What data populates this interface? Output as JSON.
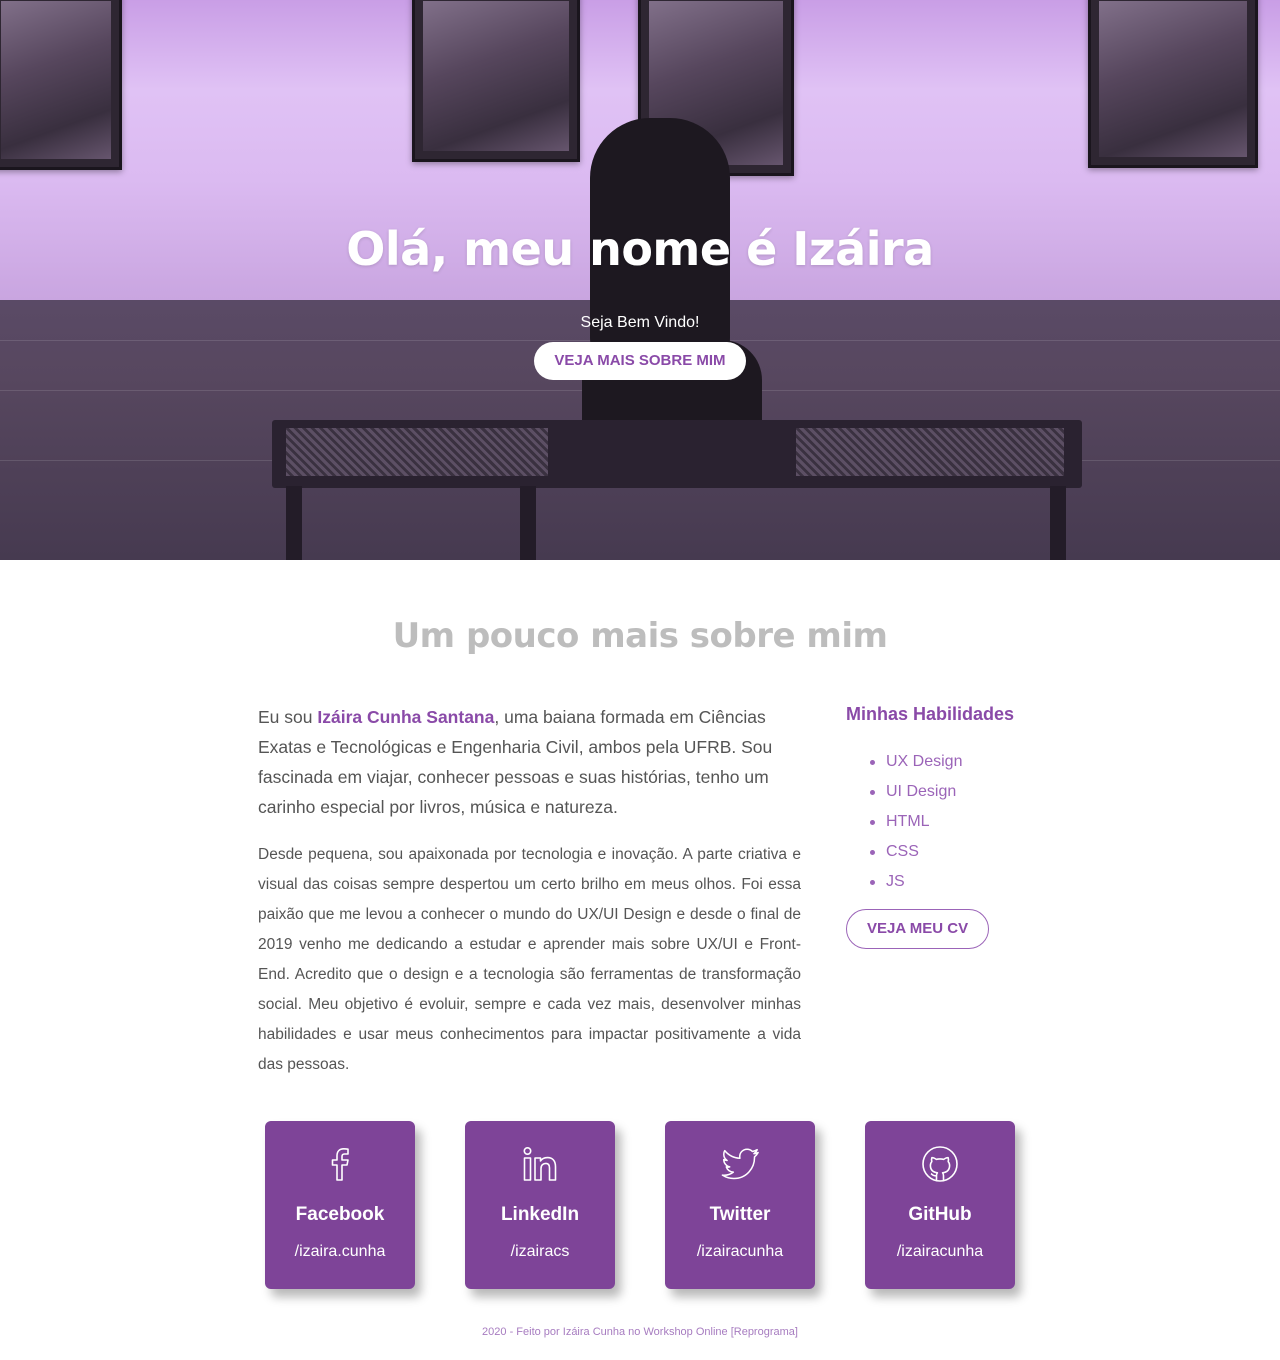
{
  "hero": {
    "title": "Olá, meu nome é Izáira",
    "subtitle": "Seja Bem Vindo!",
    "button_label": "VEJA MAIS SOBRE MIM"
  },
  "about": {
    "title": "Um pouco mais sobre mim",
    "p1_prefix": "Eu sou ",
    "p1_name": "Izáira Cunha Santana",
    "p1_suffix": ", uma baiana formada em Ciências Exatas e Tecnológicas e Engenharia Civil, ambos pela UFRB. Sou fascinada em viajar, conhecer pessoas e suas histórias, tenho um carinho especial por livros, música e natureza.",
    "p2": "Desde pequena, sou apaixonada por tecnologia e inovação. A parte criativa e visual das coisas sempre despertou um certo brilho em meus olhos. Foi essa paixão que me levou a conhecer o mundo do UX/UI Design e desde o final de 2019 venho me dedicando a estudar e aprender mais sobre UX/UI e Front-End. Acredito que o design e a tecnologia são ferramentas de transformação social. Meu objetivo é evoluir, sempre e cada vez mais, desenvolver minhas habilidades e usar meus conhecimentos para impactar positivamente a vida das pessoas."
  },
  "skills": {
    "title": "Minhas Habilidades",
    "items": [
      "UX Design",
      "UI Design",
      "HTML",
      "CSS",
      "JS"
    ],
    "cv_button": "VEJA MEU CV"
  },
  "social": [
    {
      "name": "Facebook",
      "user": "/izaira.cunha",
      "icon": "facebook-icon"
    },
    {
      "name": "LinkedIn",
      "user": "/izairacs",
      "icon": "linkedin-icon"
    },
    {
      "name": "Twitter",
      "user": "/izairacunha",
      "icon": "twitter-icon"
    },
    {
      "name": "GitHub",
      "user": "/izairacunha",
      "icon": "github-icon"
    }
  ],
  "footer": "2020 - Feito por Izáira Cunha no Workshop Online [Reprograma]",
  "colors": {
    "accent": "#8a4aa8",
    "card": "#7e4498",
    "heading_gray": "#bdbdbd"
  }
}
